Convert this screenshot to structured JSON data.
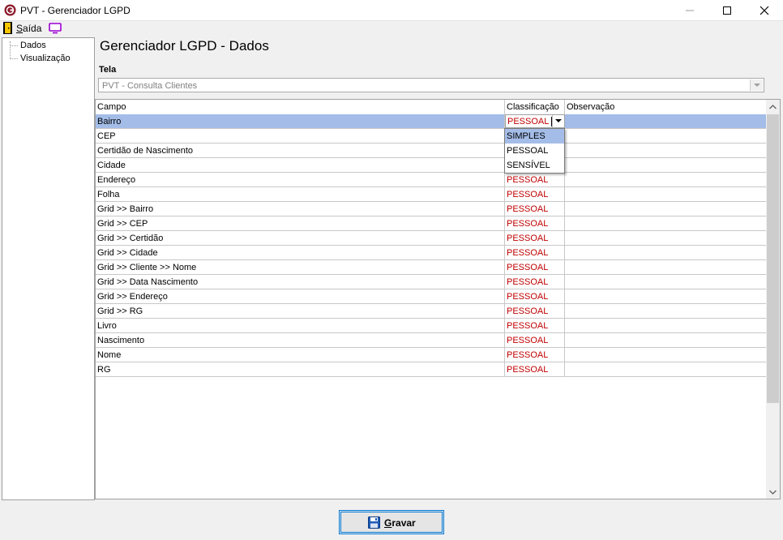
{
  "window": {
    "title": "PVT - Gerenciador LGPD"
  },
  "menu": {
    "exit_label_first": "S",
    "exit_label_rest": "aída"
  },
  "tree": {
    "items": [
      "Dados",
      "Visualização"
    ]
  },
  "page": {
    "title": "Gerenciador LGPD - Dados",
    "tela_label": "Tela"
  },
  "screen_select": {
    "value": "PVT - Consulta Clientes"
  },
  "grid": {
    "columns": [
      "Campo",
      "Classificação",
      "Observação"
    ],
    "rows": [
      {
        "campo": "Bairro",
        "classificacao": "PESSOAL",
        "observacao": ""
      },
      {
        "campo": "CEP",
        "classificacao": "",
        "observacao": ""
      },
      {
        "campo": "Certidão de Nascimento",
        "classificacao": "",
        "observacao": ""
      },
      {
        "campo": "Cidade",
        "classificacao": "",
        "observacao": ""
      },
      {
        "campo": "Endereço",
        "classificacao": "PESSOAL",
        "observacao": ""
      },
      {
        "campo": "Folha",
        "classificacao": "PESSOAL",
        "observacao": ""
      },
      {
        "campo": "Grid >> Bairro",
        "classificacao": "PESSOAL",
        "observacao": ""
      },
      {
        "campo": "Grid >> CEP",
        "classificacao": "PESSOAL",
        "observacao": ""
      },
      {
        "campo": "Grid >> Certidão",
        "classificacao": "PESSOAL",
        "observacao": ""
      },
      {
        "campo": "Grid >> Cidade",
        "classificacao": "PESSOAL",
        "observacao": ""
      },
      {
        "campo": "Grid >> Cliente >> Nome",
        "classificacao": "PESSOAL",
        "observacao": ""
      },
      {
        "campo": "Grid >> Data Nascimento",
        "classificacao": "PESSOAL",
        "observacao": ""
      },
      {
        "campo": "Grid >> Endereço",
        "classificacao": "PESSOAL",
        "observacao": ""
      },
      {
        "campo": "Grid >> RG",
        "classificacao": "PESSOAL",
        "observacao": ""
      },
      {
        "campo": "Livro",
        "classificacao": "PESSOAL",
        "observacao": ""
      },
      {
        "campo": "Nascimento",
        "classificacao": "PESSOAL",
        "observacao": ""
      },
      {
        "campo": "Nome",
        "classificacao": "PESSOAL",
        "observacao": ""
      },
      {
        "campo": "RG",
        "classificacao": "PESSOAL",
        "observacao": ""
      }
    ],
    "selected_row": 0,
    "dropdown_options": [
      "SIMPLES",
      "PESSOAL",
      "SENSÍVEL"
    ],
    "dropdown_highlighted": 0
  },
  "actions": {
    "save_label_first": "G",
    "save_label_rest": "ravar"
  },
  "colors": {
    "selection": "#a4bde8",
    "classification_text": "#c00000",
    "button_border": "#0078d7"
  },
  "icons": {
    "app": "app-logo-icon",
    "exit": "door-exit-icon",
    "monitor": "monitor-icon",
    "save": "floppy-disk-icon"
  }
}
